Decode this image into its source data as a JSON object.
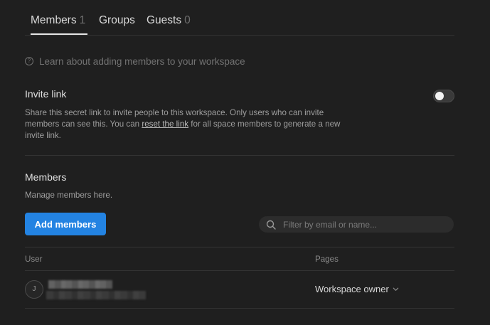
{
  "tabs": [
    {
      "label": "Members",
      "count": "1",
      "active": true
    },
    {
      "label": "Groups",
      "count": "",
      "active": false
    },
    {
      "label": "Guests",
      "count": "0",
      "active": false
    }
  ],
  "learn_link": {
    "icon": "help-circle-icon",
    "text": "Learn about adding members to your workspace"
  },
  "invite": {
    "title": "Invite link",
    "desc_before": "Share this secret link to invite people to this workspace. Only users who can invite members can see this. You can ",
    "desc_link": "reset the link",
    "desc_after": " for all space members to generate a new invite link.",
    "toggle_on": false
  },
  "members": {
    "title": "Members",
    "desc": "Manage members here.",
    "add_label": "Add members",
    "search_placeholder": "Filter by email or name...",
    "search_value": ""
  },
  "table": {
    "columns": [
      "User",
      "Pages"
    ],
    "rows": [
      {
        "avatar_initial": "J",
        "role": "Workspace owner"
      }
    ]
  },
  "colors": {
    "background": "#1f1f1f",
    "accent": "#2383e2"
  }
}
